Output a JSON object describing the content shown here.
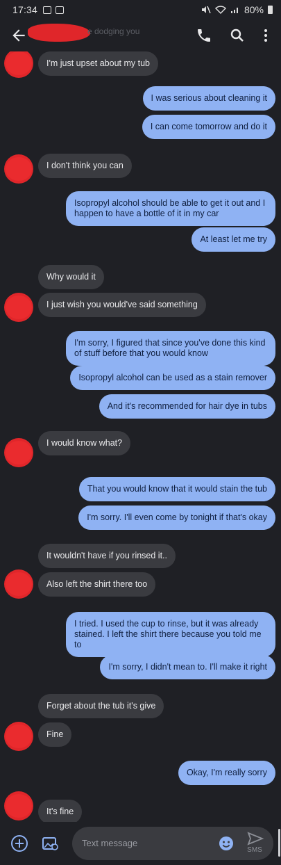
{
  "status": {
    "time": "17:34",
    "battery": "80%"
  },
  "app_bar": {
    "subtitle": "e dodging you"
  },
  "messages": [
    {
      "dir": "in",
      "text": "I'm just upset about my tub"
    },
    {
      "dir": "out",
      "text": "I was serious about cleaning it"
    },
    {
      "dir": "out",
      "text": "I can come tomorrow and do it"
    },
    {
      "dir": "in",
      "text": "I don't think you can"
    },
    {
      "dir": "out",
      "text": "Isopropyl alcohol should be able to get it out and I happen to have a bottle of it in my car"
    },
    {
      "dir": "out",
      "text": "At least let me try"
    },
    {
      "dir": "in",
      "text": "Why would it"
    },
    {
      "dir": "in",
      "text": "I just wish you would've said something"
    },
    {
      "dir": "out",
      "text": "I'm sorry, I figured that since you've done this kind of stuff before that you would know"
    },
    {
      "dir": "out",
      "text": "Isopropyl alcohol can be used as a stain remover"
    },
    {
      "dir": "out",
      "text": "And it's recommended for hair dye in tubs"
    },
    {
      "dir": "in",
      "text": "I would know what?"
    },
    {
      "dir": "out",
      "text": "That you would know that it would stain the tub"
    },
    {
      "dir": "out",
      "text": "I'm sorry. I'll even come by tonight if that's okay"
    },
    {
      "dir": "in",
      "text": "It wouldn't have if you rinsed it.."
    },
    {
      "dir": "in",
      "text": "Also left the shirt there too"
    },
    {
      "dir": "out",
      "text": "I tried. I used the cup to rinse, but it was already stained. I left the shirt there because you told me to"
    },
    {
      "dir": "out",
      "text": "I'm sorry, I didn't mean to. I'll make it right"
    },
    {
      "dir": "in",
      "text": "Forget about the tub it's give"
    },
    {
      "dir": "in",
      "text": "Fine"
    },
    {
      "dir": "out",
      "text": "Okay, I'm really sorry"
    },
    {
      "dir": "in",
      "text": "It's fine"
    }
  ],
  "composer": {
    "placeholder": "Text message",
    "send_label": "SMS"
  },
  "icons": {
    "back": "arrow-left-icon",
    "call": "phone-icon",
    "search": "search-icon",
    "more": "more-vert-icon",
    "add": "add-circle-icon",
    "gallery": "gallery-icon",
    "emoji": "emoji-icon",
    "send": "send-icon"
  },
  "colors": {
    "background": "#1f2025",
    "incoming": "#3a3b40",
    "outgoing": "#8fb2f3",
    "redaction": "#e0262a"
  }
}
